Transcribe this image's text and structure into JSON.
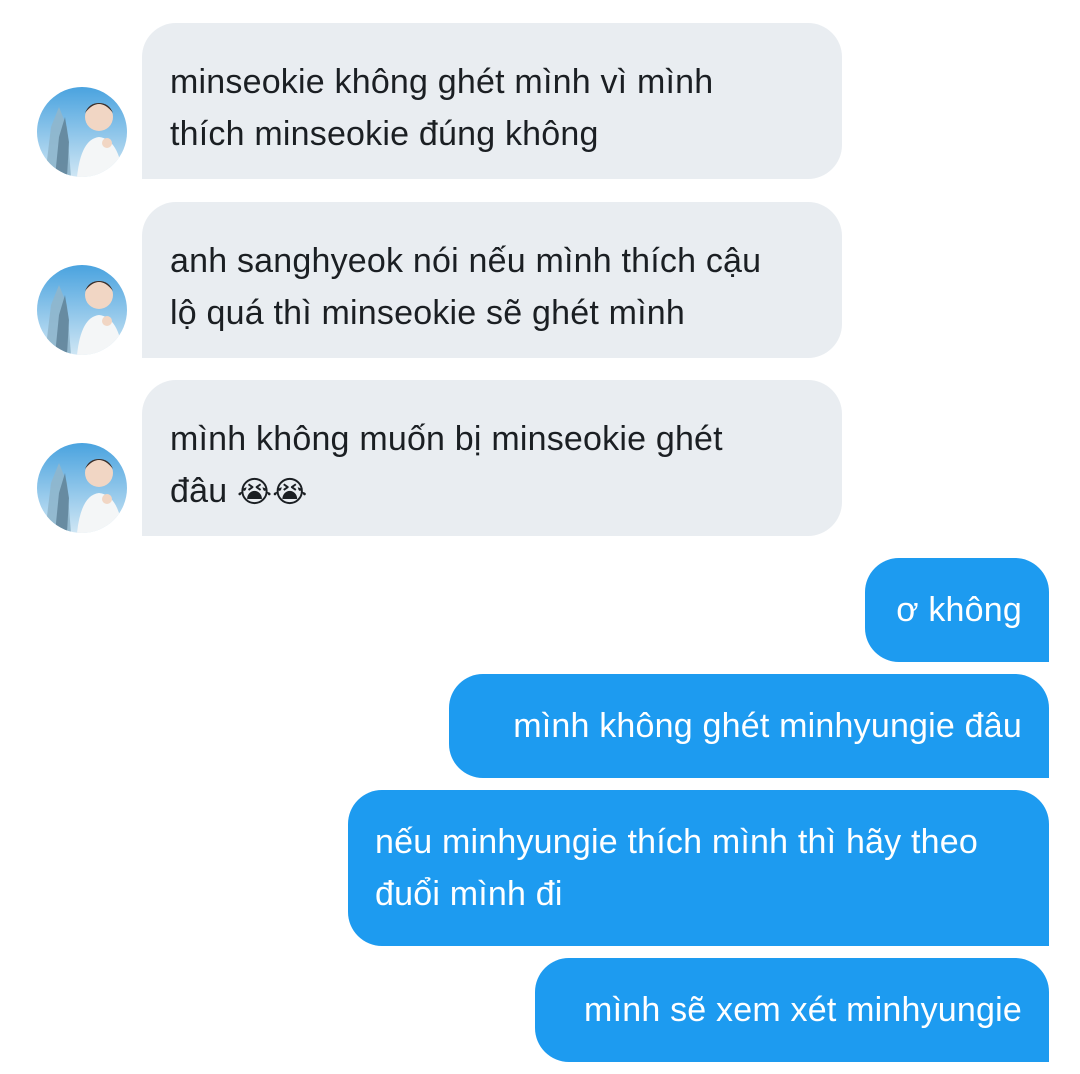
{
  "conversation": {
    "incoming": [
      {
        "avatar_icon": "user-avatar-photo",
        "lines": [
          "minseokie không ghét mình vì mình",
          "thích minseokie đúng không"
        ]
      },
      {
        "avatar_icon": "user-avatar-photo",
        "lines": [
          "anh sanghyeok nói nếu mình thích cậu",
          "lộ quá thì minseokie sẽ ghét mình"
        ]
      },
      {
        "avatar_icon": "user-avatar-photo",
        "lines": [
          "mình không muốn bị minseokie ghét",
          "đâu"
        ],
        "emoji": "😭😭"
      }
    ],
    "outgoing": [
      {
        "lines": [
          "ơ không"
        ]
      },
      {
        "lines": [
          "mình không ghét minhyungie đâu"
        ]
      },
      {
        "lines": [
          "nếu minhyungie thích mình thì hãy theo",
          "đuổi mình đi"
        ]
      },
      {
        "lines": [
          "mình sẽ xem xét minhyungie"
        ]
      }
    ]
  },
  "colors": {
    "incoming_bubble": "#e9edf1",
    "outgoing_bubble": "#1d9bf0",
    "incoming_text": "#1b1f23",
    "outgoing_text": "#ffffff"
  }
}
